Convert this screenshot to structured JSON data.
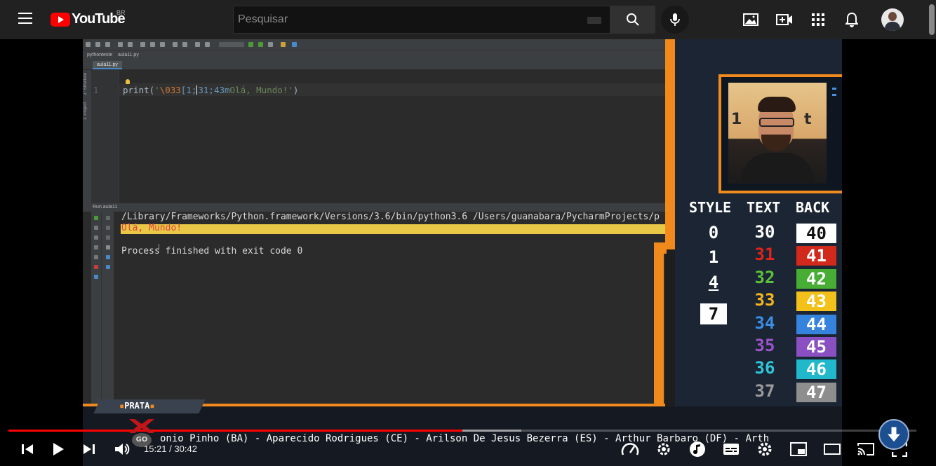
{
  "topbar": {
    "logo_text": "YouTube",
    "country_code": "BR",
    "search": {
      "placeholder": "Pesquisar",
      "value": ""
    },
    "icons": [
      "menu-icon",
      "search-icon",
      "mic-icon",
      "image-icon",
      "create-video-icon",
      "apps-grid-icon",
      "notification-bell-icon",
      "account-avatar"
    ]
  },
  "ide": {
    "project_name": "pythonteste",
    "breadcrumb_file": "aula11.py",
    "tab_label": "aula11.py",
    "side_labels": [
      "Z: Structure",
      "1: Project"
    ],
    "line_number": "1",
    "code": {
      "fn": "print(",
      "str_open": "'",
      "escape": "\\033",
      "ansi_a": "[1;",
      "ansi_b": "31;43m",
      "text": "Olá, Mundo!",
      "str_close": "'",
      "close": ")"
    },
    "run_header": "Run",
    "run_tab": "aula11",
    "console": {
      "command": "/Library/Frameworks/Python.framework/Versions/3.6/bin/python3.6 /Users/guanabara/PycharmProjects/p",
      "output": "Olá, Mundo!",
      "finished": "Process finished with exit code 0"
    }
  },
  "overlay": {
    "table_headers": [
      "STYLE",
      "TEXT",
      "BACK"
    ],
    "style_values": [
      "0",
      "1",
      "4",
      "7"
    ],
    "text_values": [
      {
        "label": "30",
        "color": "#ffffff"
      },
      {
        "label": "31",
        "color": "#e0241b"
      },
      {
        "label": "32",
        "color": "#5cc23c"
      },
      {
        "label": "33",
        "color": "#f2b51f"
      },
      {
        "label": "34",
        "color": "#3b8de6"
      },
      {
        "label": "35",
        "color": "#9b55c9"
      },
      {
        "label": "36",
        "color": "#2fc6d9"
      },
      {
        "label": "37",
        "color": "#9a9a9a"
      }
    ],
    "back_values": [
      {
        "label": "40",
        "bg": "#ffffff",
        "fg": "#111111"
      },
      {
        "label": "41",
        "bg": "#d12a1c",
        "fg": "#ffffff"
      },
      {
        "label": "42",
        "bg": "#47ad34",
        "fg": "#ffffff"
      },
      {
        "label": "43",
        "bg": "#f2c21b",
        "fg": "#ffffff"
      },
      {
        "label": "44",
        "bg": "#3583dc",
        "fg": "#ffffff"
      },
      {
        "label": "45",
        "bg": "#8a4fc0",
        "fg": "#ffffff"
      },
      {
        "label": "46",
        "bg": "#22b8cc",
        "fg": "#ffffff"
      },
      {
        "label": "47",
        "bg": "#8e8e8e",
        "fg": "#ffffff"
      }
    ],
    "webcam_bg_text_left": "1",
    "webcam_bg_text_right": "t",
    "tier_label": "PRATA",
    "ticker": "onio Pinho (BA) - Aparecido Rodrigues (CE) - Arilson De Jesus Bezerra (ES) - Arthur Barbaro (DF) - Arth",
    "go_badge": "GO"
  },
  "player": {
    "current_time": "15:21",
    "separator": " / ",
    "duration": "30:42",
    "played_fraction": 0.4998,
    "loaded_fraction": 0.565,
    "icons": [
      "previous-icon",
      "play-icon",
      "next-icon",
      "volume-icon",
      "speed-icon",
      "settings-cog-icon",
      "music-note-icon",
      "subtitles-icon",
      "settings-icon",
      "miniplayer-icon",
      "theater-mode-icon",
      "cast-icon",
      "fullscreen-icon",
      "scroll-down-fab"
    ]
  }
}
